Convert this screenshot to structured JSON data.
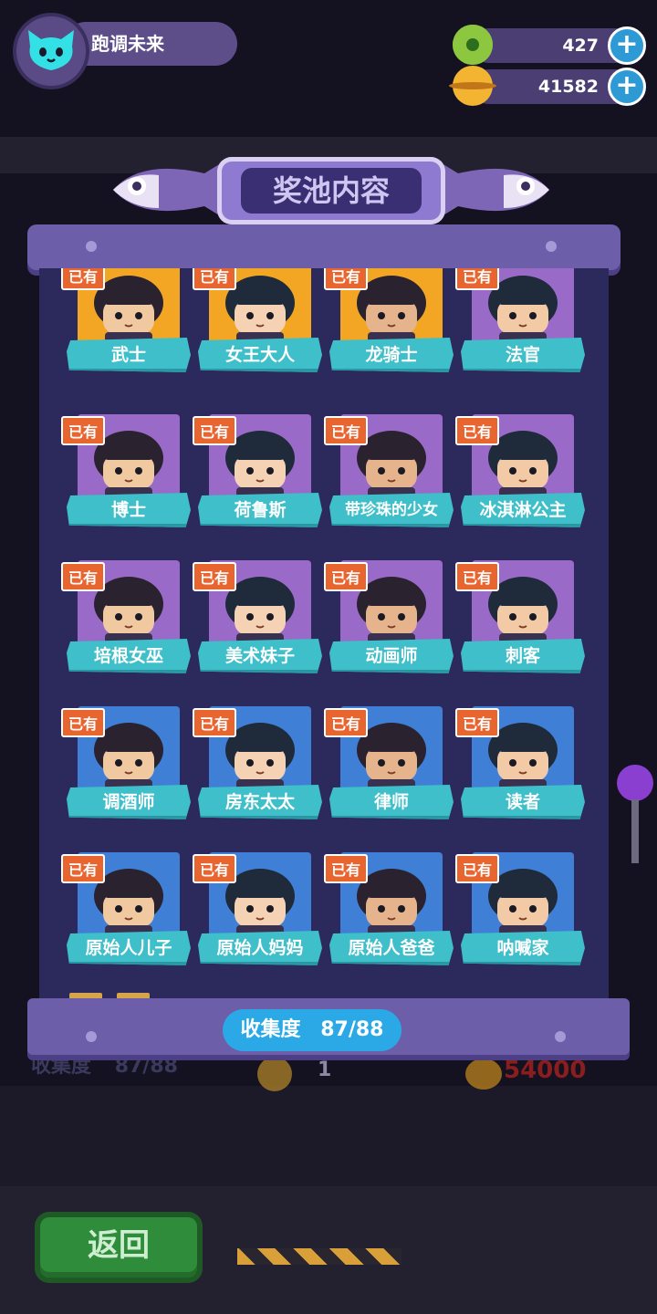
{
  "header": {
    "player_name": "跑调未来",
    "currency_1": {
      "value": "427",
      "color": "#8dc63f"
    },
    "currency_2": {
      "value": "41582",
      "color": "#f3b431"
    }
  },
  "panel": {
    "title": "奖池内容",
    "collection_label": "收集度",
    "collection_value": "87/88"
  },
  "owned_badge": "已有",
  "characters": [
    {
      "name": "武士",
      "card_color": "#f2a623",
      "owned": true
    },
    {
      "name": "女王大人",
      "card_color": "#f2a623",
      "owned": true
    },
    {
      "name": "龙骑士",
      "card_color": "#f2a623",
      "owned": true
    },
    {
      "name": "法官",
      "card_color": "#9a6ac9",
      "owned": true
    },
    {
      "name": "博士",
      "card_color": "#9a6ac9",
      "owned": true
    },
    {
      "name": "荷鲁斯",
      "card_color": "#9a6ac9",
      "owned": true
    },
    {
      "name": "带珍珠的少女",
      "card_color": "#9a6ac9",
      "owned": true
    },
    {
      "name": "冰淇淋公主",
      "card_color": "#9a6ac9",
      "owned": true
    },
    {
      "name": "培根女巫",
      "card_color": "#9a6ac9",
      "owned": true
    },
    {
      "name": "美术妹子",
      "card_color": "#9a6ac9",
      "owned": true
    },
    {
      "name": "动画师",
      "card_color": "#9a6ac9",
      "owned": true
    },
    {
      "name": "刺客",
      "card_color": "#9a6ac9",
      "owned": true
    },
    {
      "name": "调酒师",
      "card_color": "#3f7fd6",
      "owned": true
    },
    {
      "name": "房东太太",
      "card_color": "#3f7fd6",
      "owned": true
    },
    {
      "name": "律师",
      "card_color": "#3f7fd6",
      "owned": true
    },
    {
      "name": "读者",
      "card_color": "#3f7fd6",
      "owned": true
    },
    {
      "name": "原始人儿子",
      "card_color": "#3f7fd6",
      "owned": true
    },
    {
      "name": "原始人妈妈",
      "card_color": "#3f7fd6",
      "owned": true
    },
    {
      "name": "原始人爸爸",
      "card_color": "#3f7fd6",
      "owned": true
    },
    {
      "name": "呐喊家",
      "card_color": "#3f7fd6",
      "owned": true
    }
  ],
  "background": {
    "ghost_collection_label": "收集度",
    "ghost_collection_value": "87/88",
    "ghost_count": "1",
    "ghost_price": "54000"
  },
  "footer": {
    "back_label": "返回"
  }
}
